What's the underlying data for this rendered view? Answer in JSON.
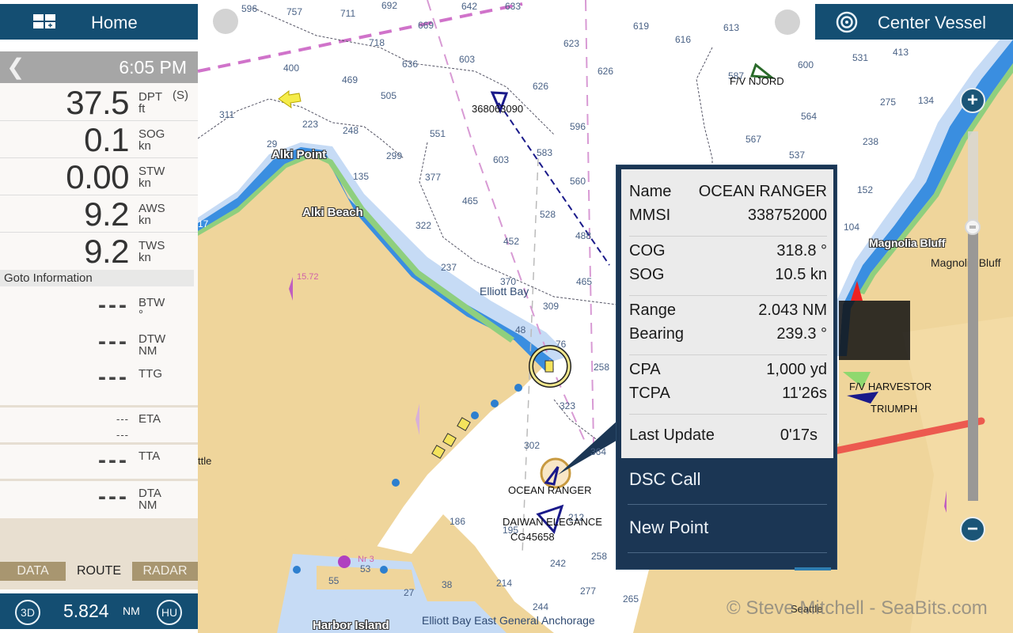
{
  "header": {
    "home_label": "Home",
    "home_icon": "grid-add-icon",
    "center_vessel_label": "Center Vessel",
    "center_vessel_icon": "target-icon"
  },
  "status": {
    "back_icon": "chevron-left-icon",
    "time": "6:05 PM"
  },
  "instruments": [
    {
      "value": "37.5",
      "label": "DPT",
      "unit": "ft",
      "extra": "(S)"
    },
    {
      "value": "0.1",
      "label": "SOG",
      "unit": "kn"
    },
    {
      "value": "0.00",
      "label": "STW",
      "unit": "kn"
    },
    {
      "value": "9.2",
      "label": "AWS",
      "unit": "kn"
    },
    {
      "value": "9.2",
      "label": "TWS",
      "unit": "kn"
    }
  ],
  "goto": {
    "title": "Goto Information",
    "rows": [
      {
        "value": "---",
        "label": "BTW",
        "unit": "°"
      },
      {
        "value": "---",
        "label": "DTW",
        "unit": "NM"
      },
      {
        "value": "---",
        "label": "TTG",
        "unit": ""
      },
      {
        "value": "---",
        "label": "ETA",
        "unit": "",
        "value2": "---"
      },
      {
        "value": "---",
        "label": "TTA",
        "unit": ""
      },
      {
        "value": "---",
        "label": "DTA",
        "unit": "NM"
      }
    ]
  },
  "tabs": [
    {
      "label": "DATA",
      "active": false
    },
    {
      "label": "ROUTE",
      "active": true
    },
    {
      "label": "RADAR",
      "active": false
    }
  ],
  "bottom_bar": {
    "left_button": "3D",
    "range_value": "5.824",
    "range_unit": "NM",
    "right_button": "HU"
  },
  "zoom": {
    "in_label": "+",
    "out_label": "−",
    "level_fraction": 0.26
  },
  "ais_popup": {
    "fields": [
      {
        "key": "Name",
        "value": "OCEAN RANGER"
      },
      {
        "key": "MMSI",
        "value": "338752000"
      },
      {
        "key": "COG",
        "value": "318.8 °"
      },
      {
        "key": "SOG",
        "value": "10.5 kn"
      },
      {
        "key": "Range",
        "value": "2.043 NM"
      },
      {
        "key": "Bearing",
        "value": "239.3 °"
      },
      {
        "key": "CPA",
        "value": "1,000 yd"
      },
      {
        "key": "TCPA",
        "value": "11'26s"
      },
      {
        "key": "Last Update",
        "value": "0'17s"
      }
    ],
    "menu": [
      {
        "label": "DSC Call"
      },
      {
        "label": "New Point"
      }
    ]
  },
  "map": {
    "places": [
      {
        "name": "Alki Point",
        "style": "outline"
      },
      {
        "name": "Alki Beach",
        "style": "outline"
      },
      {
        "name": "Elliott Bay",
        "style": "water"
      },
      {
        "name": "Magnolia Bluff",
        "style": "outline"
      },
      {
        "name": "Magnolia Bluff",
        "style": "land"
      },
      {
        "name": "Harbor Island",
        "style": "outline"
      },
      {
        "name": "Elliott Bay East General Anchorage",
        "style": "water"
      },
      {
        "name": "ttle",
        "style": "land"
      },
      {
        "name": "Seattle",
        "style": "land"
      },
      {
        "name": "Nr 3",
        "style": "magenta"
      }
    ],
    "vessels": [
      {
        "name": "368063090"
      },
      {
        "name": "F/V NJORD"
      },
      {
        "name": "OCEAN RANGER"
      },
      {
        "name": "DAIWAN ELEGANCE"
      },
      {
        "name": "CG45658"
      },
      {
        "name": "F/V HARVESTOR"
      },
      {
        "name": "TRIUMPH"
      }
    ],
    "depths": [
      "596",
      "757",
      "711",
      "692",
      "642",
      "633",
      "669",
      "718",
      "623",
      "626",
      "619",
      "616",
      "613",
      "600",
      "531",
      "413",
      "400",
      "469",
      "636",
      "603",
      "626",
      "505",
      "311",
      "223",
      "248",
      "551",
      "583",
      "596",
      "587",
      "564",
      "567",
      "537",
      "275",
      "134",
      "238",
      "152",
      "104",
      "299",
      "135",
      "377",
      "603",
      "560",
      "465",
      "528",
      "322",
      "452",
      "488",
      "237",
      "370",
      "465",
      "309",
      "48",
      "76",
      "258",
      "323",
      "302",
      "364",
      "186",
      "212",
      "195",
      "242",
      "258",
      "214",
      "277",
      "244",
      "265",
      "55",
      "53",
      "38",
      "27",
      "15.72",
      "29",
      "17"
    ],
    "watermark": "© Steve Mitchell - SeaBits.com"
  }
}
